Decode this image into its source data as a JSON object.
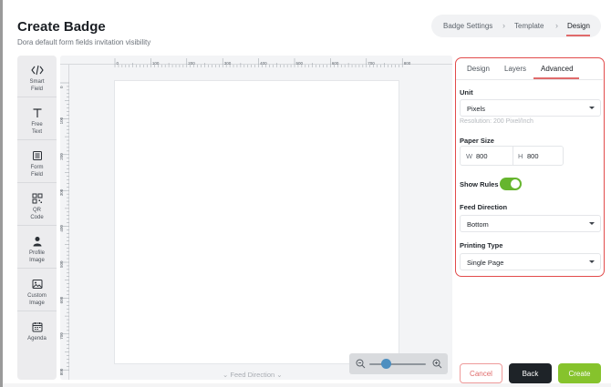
{
  "header": {
    "title": "Create Badge",
    "subtitle": "Dora default form fields invitation visibility"
  },
  "steps": [
    {
      "label": "Badge Settings",
      "active": false
    },
    {
      "label": "Template",
      "active": false
    },
    {
      "label": "Design",
      "active": true
    }
  ],
  "toolbox": [
    {
      "label": "Smart\nField",
      "icon": "code-icon"
    },
    {
      "label": "Free\nText",
      "icon": "text-icon"
    },
    {
      "label": "Form\nField",
      "icon": "form-icon"
    },
    {
      "label": "QR\nCode",
      "icon": "qr-icon"
    },
    {
      "label": "Profile\nImage",
      "icon": "person-icon"
    },
    {
      "label": "Custom\nImage",
      "icon": "image-icon"
    },
    {
      "label": "Agenda",
      "icon": "calendar-icon"
    }
  ],
  "canvas": {
    "ruler_top_labels": [
      "0",
      "100",
      "200",
      "300",
      "400",
      "500",
      "600",
      "700",
      "800"
    ],
    "ruler_left_labels": [
      "0",
      "100",
      "200",
      "300",
      "400",
      "500",
      "600",
      "700",
      "800"
    ],
    "feed_direction_label": "Feed Direction",
    "zoom_level": 0.3
  },
  "panel": {
    "tabs": [
      {
        "label": "Design",
        "active": false
      },
      {
        "label": "Layers",
        "active": false
      },
      {
        "label": "Advanced",
        "active": true
      }
    ],
    "unit_label": "Unit",
    "unit_value": "Pixels",
    "resolution_hint": "Resolution: 200 Pixel/Inch",
    "paper_size_label": "Paper Size",
    "width_key": "W",
    "width_value": "800",
    "height_key": "H",
    "height_value": "800",
    "show_rules_label": "Show Rules",
    "show_rules_on": true,
    "feed_direction_label": "Feed Direction",
    "feed_direction_value": "Bottom",
    "printing_type_label": "Printing Type",
    "printing_type_value": "Single Page"
  },
  "actions": {
    "cancel": "Cancel",
    "back": "Back",
    "create": "Create"
  },
  "colors": {
    "accent_red": "#e24b4b",
    "create_green": "#86c32c",
    "toggle_green": "#66b52e",
    "back_dark": "#1e2328"
  }
}
